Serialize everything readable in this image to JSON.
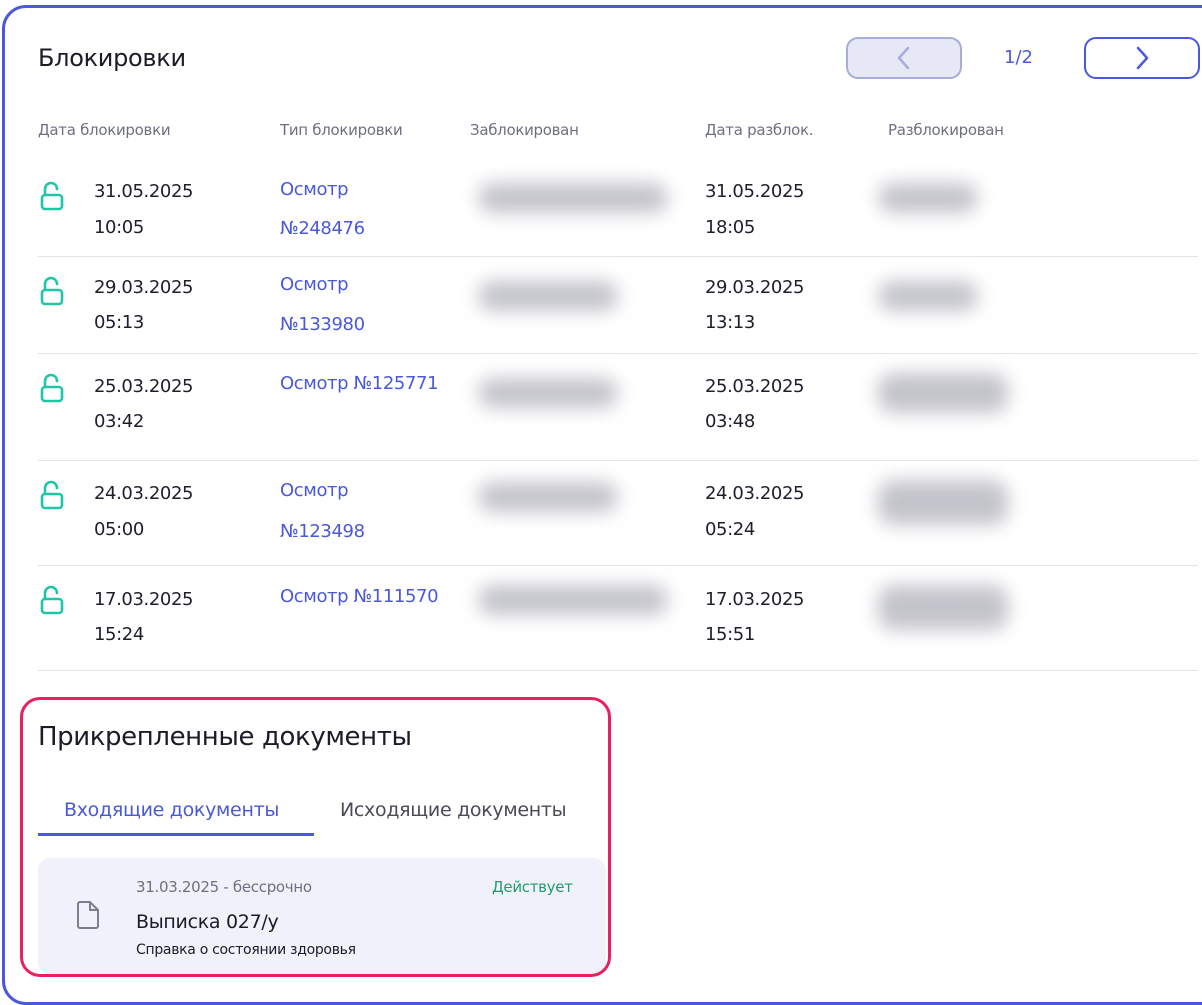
{
  "blocks": {
    "title": "Блокировки",
    "pager": {
      "current": "1/2"
    },
    "columns": {
      "date": "Дата блокировки",
      "type": "Тип блокировки",
      "blocked_by": "Заблокирован",
      "unlock_date": "Дата разблок.",
      "unlocked_by": "Разблокирован"
    },
    "rows": [
      {
        "date": "31.05.2025",
        "time": "10:05",
        "type_a": "Осмотр",
        "type_b": "№248476",
        "unlock_date": "31.05.2025",
        "unlock_time": "18:05"
      },
      {
        "date": "29.03.2025",
        "time": "05:13",
        "type_a": "Осмотр",
        "type_b": "№133980",
        "unlock_date": "29.03.2025",
        "unlock_time": "13:13"
      },
      {
        "date": "25.03.2025",
        "time": "03:42",
        "type_a": "Осмотр №125771",
        "type_b": "",
        "unlock_date": "25.03.2025",
        "unlock_time": "03:48"
      },
      {
        "date": "24.03.2025",
        "time": "05:00",
        "type_a": "Осмотр",
        "type_b": "№123498",
        "unlock_date": "24.03.2025",
        "unlock_time": "05:24"
      },
      {
        "date": "17.03.2025",
        "time": "15:24",
        "type_a": "Осмотр №111570",
        "type_b": "",
        "unlock_date": "17.03.2025",
        "unlock_time": "15:51"
      }
    ]
  },
  "documents": {
    "title": "Прикрепленные документы",
    "tabs": {
      "incoming": "Входящие документы",
      "outgoing": "Исходящие документы"
    },
    "items": [
      {
        "period": "31.03.2025 - бессрочно",
        "status": "Действует",
        "name": "Выписка 027/у",
        "description": "Справка о состоянии здоровья"
      }
    ]
  },
  "colors": {
    "accent": "#4a58dc",
    "lock": "#1ec6a6",
    "highlight": "#e8205e",
    "status_active": "#1f9d6f"
  },
  "icons": {
    "lock": "unlock-icon",
    "doc": "document-icon"
  }
}
